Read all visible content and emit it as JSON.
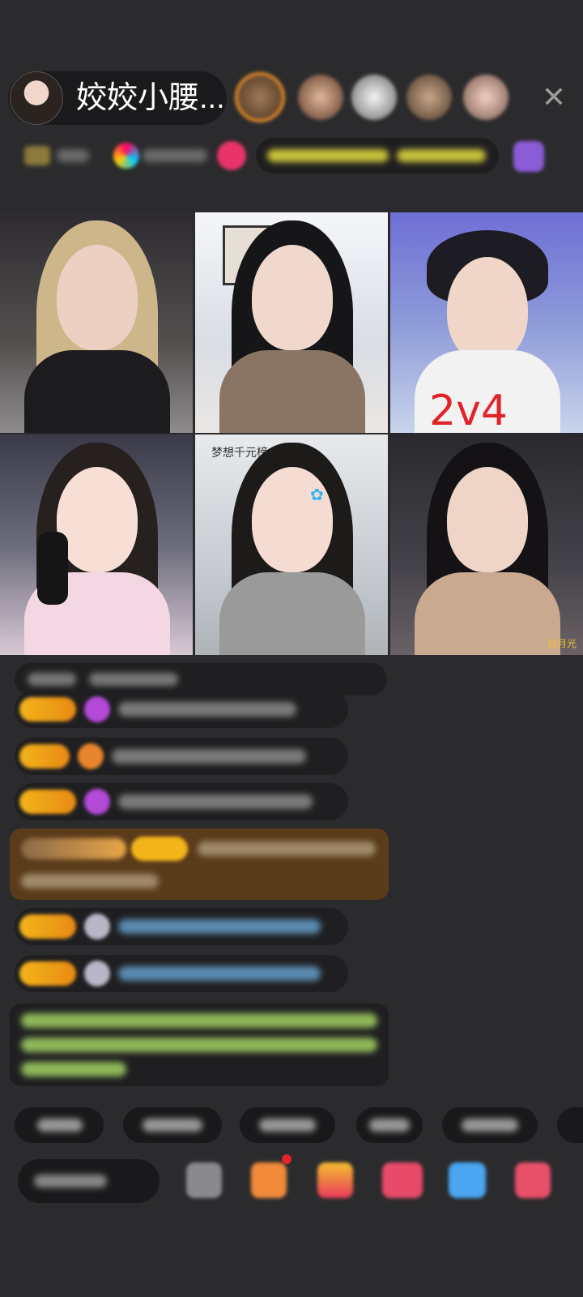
{
  "host": {
    "name": "姣姣小腰..."
  },
  "icons": {
    "close": "✕"
  },
  "grid": {
    "tile3_badge": "2v4",
    "tile5_caption": "梦想千元榜",
    "tile6_caption": "白月光"
  },
  "colors": {
    "background": "#2b2b2d",
    "level_badge": "#f3b41a",
    "badge_red": "#e2232a",
    "notice_text": "#a8d46a",
    "highlight_msg_bg": "#5a3b1a"
  }
}
